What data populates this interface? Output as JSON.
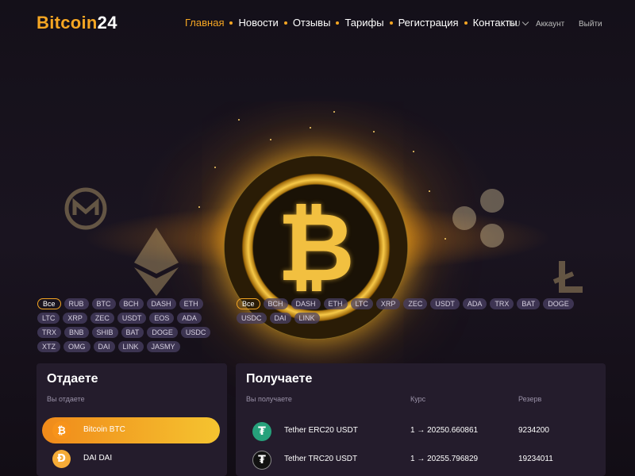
{
  "logo": {
    "part1": "Bitcoin",
    "part2": "24"
  },
  "nav": [
    "Главная",
    "Новости",
    "Отзывы",
    "Тарифы",
    "Регистрация",
    "Контакты"
  ],
  "lang": "RU",
  "account": "Аккаунт",
  "logout": "Выйти",
  "chips_left": [
    "Все",
    "RUB",
    "BTC",
    "BCH",
    "DASH",
    "ETH",
    "LTC",
    "XRP",
    "ZEC",
    "USDT",
    "EOS",
    "ADA",
    "TRX",
    "BNB",
    "SHIB",
    "BAT",
    "DOGE",
    "USDC",
    "XTZ",
    "OMG",
    "DAI",
    "LINK",
    "JASMY"
  ],
  "chips_right": [
    "Все",
    "BCH",
    "DASH",
    "ETH",
    "LTC",
    "XRP",
    "ZEC",
    "USDT",
    "ADA",
    "TRX",
    "BAT",
    "DOGE",
    "USDC",
    "DAI",
    "LINK"
  ],
  "give": {
    "title": "Отдаете",
    "subtitle": "Вы отдаете",
    "items": [
      {
        "icon": "bitcoin-icon",
        "label": "Bitcoin BTC",
        "active": true
      },
      {
        "icon": "dai-icon",
        "label": "DAI DAI",
        "active": false
      }
    ]
  },
  "get": {
    "title": "Получаете",
    "col_name": "Вы получаете",
    "col_rate": "Курс",
    "col_reserve": "Резерв",
    "rows": [
      {
        "icon": "tether-erc20-icon",
        "name": "Tether ERC20 USDT",
        "rate": "1 → 20250.660861",
        "reserve": "9234200"
      },
      {
        "icon": "tether-trc20-icon",
        "name": "Tether TRC20 USDT",
        "rate": "1 → 20255.796829",
        "reserve": "19234011"
      }
    ]
  },
  "colors": {
    "accent": "#f5a623",
    "panel": "#241c2c",
    "chip": "#4a4064"
  }
}
